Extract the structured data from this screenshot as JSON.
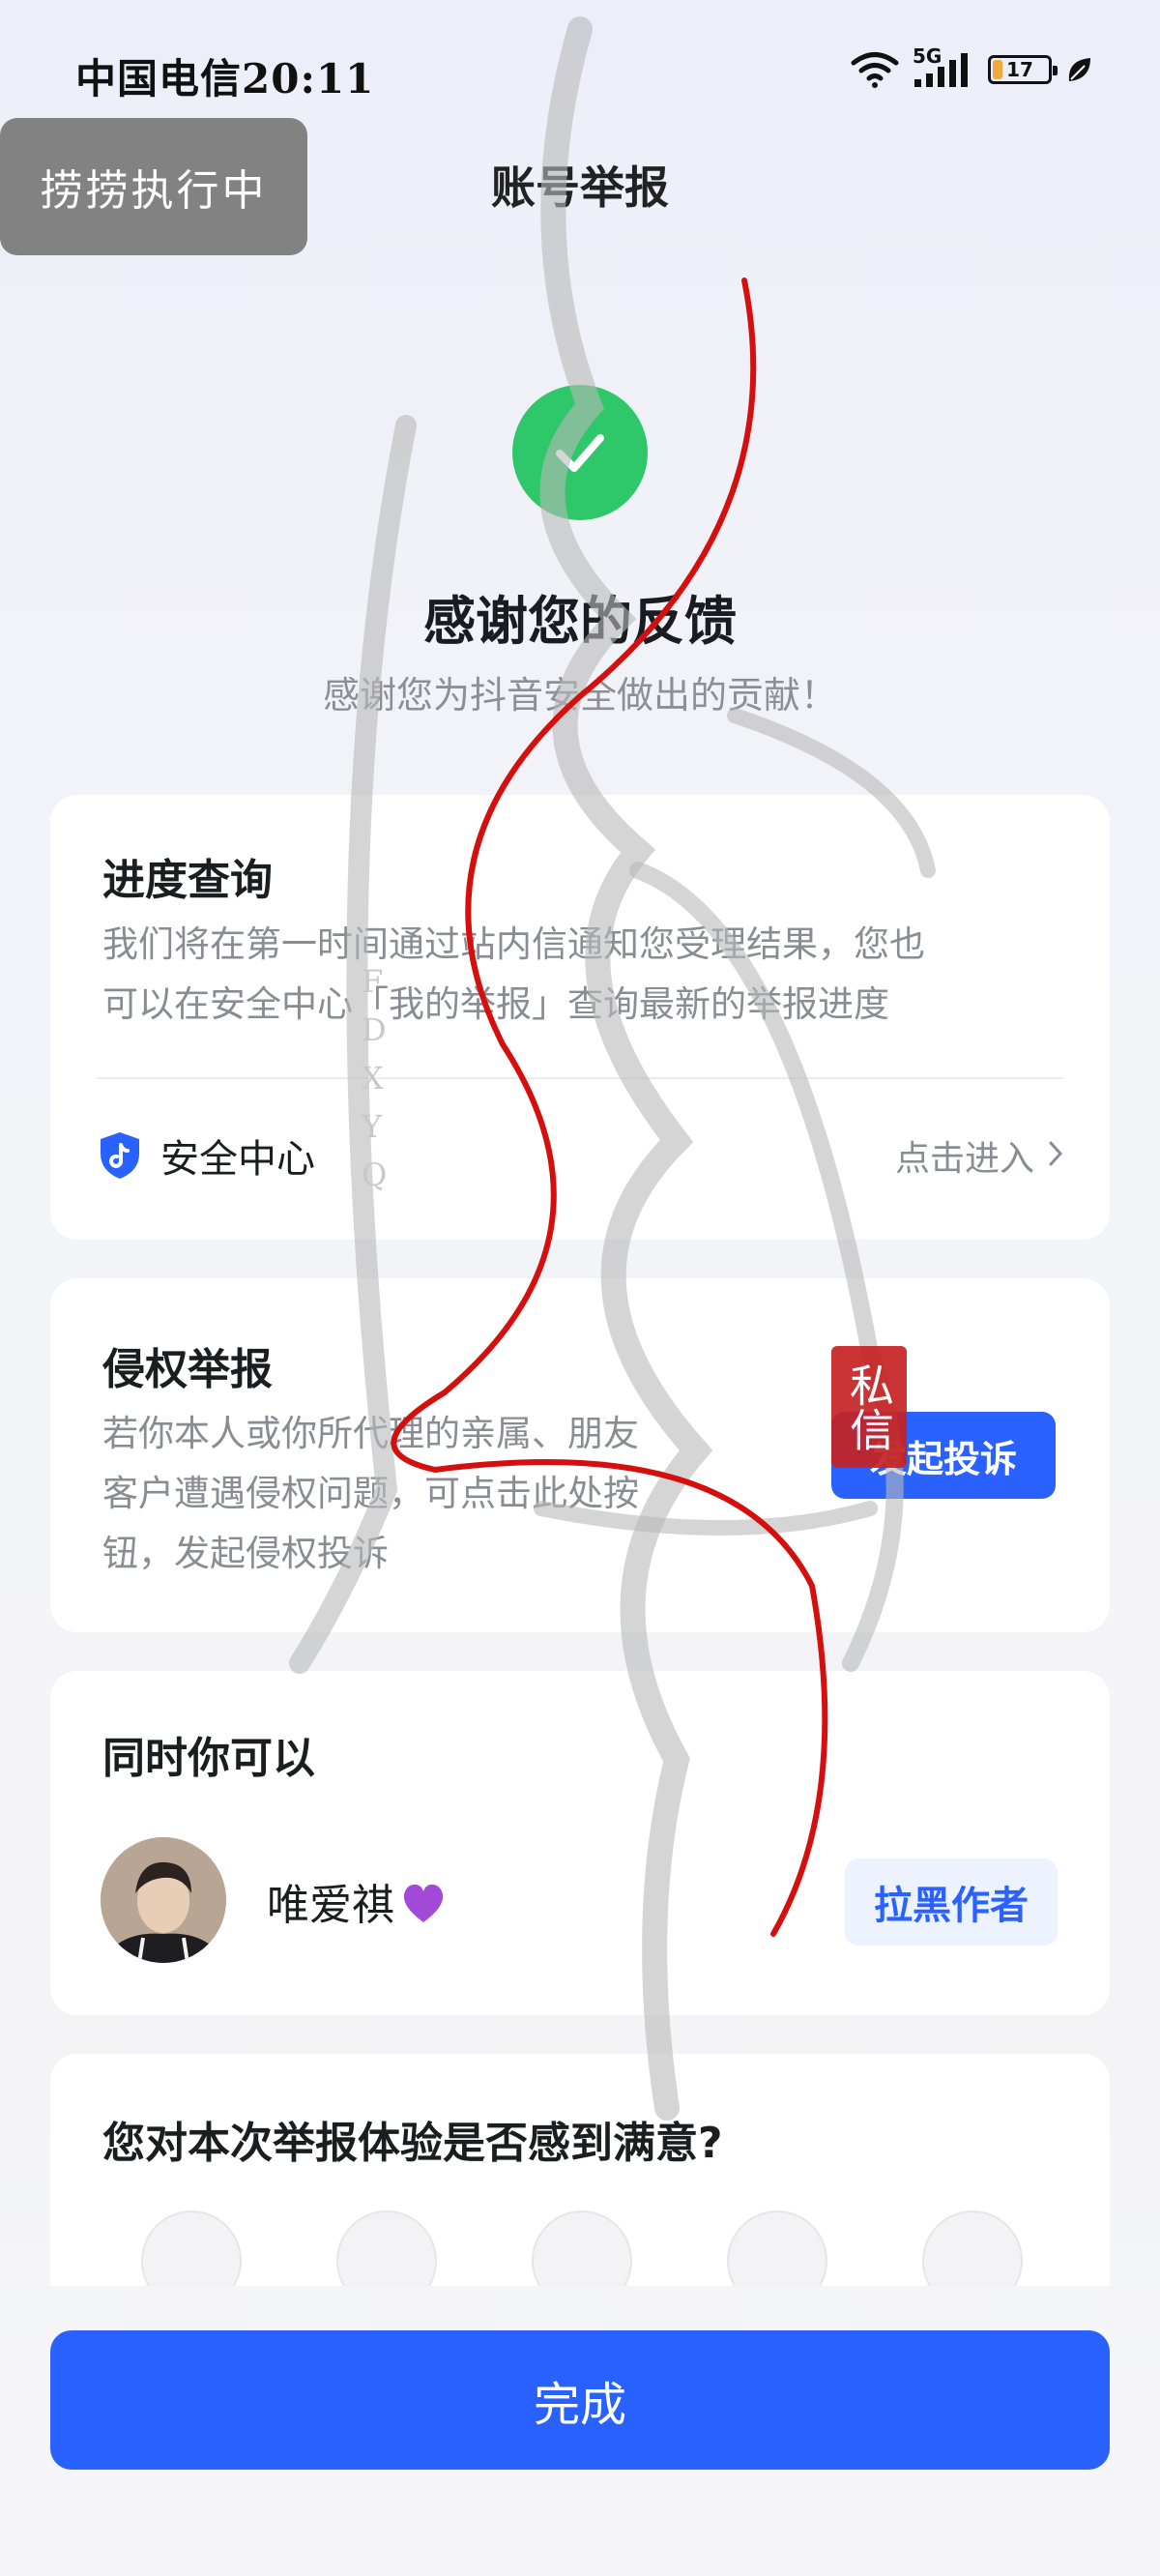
{
  "status_bar": {
    "carrier_time": "中国电信20:11",
    "network": "5G",
    "battery_level": "17",
    "battery_percent": 17
  },
  "floating_chip": {
    "label": "捞捞执行中"
  },
  "header": {
    "title": "账号举报"
  },
  "success": {
    "title": "感谢您的反馈",
    "subtitle": "感谢您为抖音安全做出的贡献！"
  },
  "progress_card": {
    "title": "进度查询",
    "description_line1": "我们将在第一时间通过站内信通知您受理结果，您也",
    "description_line2": "可以在安全中心「我的举报」查询最新的举报进度",
    "safety_center_label": "安全中心",
    "enter_label": "点击进入"
  },
  "infringement_card": {
    "title": "侵权举报",
    "description_line1": "若你本人或你所代理的亲属、朋友",
    "description_line2": "客户遭遇侵权问题，可点击此处按",
    "description_line3": "钮，发起侵权投诉",
    "button_label": "发起投诉"
  },
  "also_card": {
    "title": "同时你可以",
    "username": "唯爱祺",
    "block_label": "拉黑作者"
  },
  "survey_card": {
    "title": "您对本次举报体验是否感到满意?",
    "options": [
      "very-unsatisfied-icon",
      "unsatisfied-icon",
      "neutral-icon",
      "satisfied-icon",
      "very-satisfied-icon"
    ]
  },
  "footer": {
    "done_label": "完成"
  },
  "watermark": {
    "seal_text": "私信",
    "side_letters": [
      "F",
      "D",
      "X",
      "Y",
      "Q"
    ]
  },
  "colors": {
    "primary": "#2961ff",
    "success": "#2ec76a",
    "seal": "#c62323"
  }
}
